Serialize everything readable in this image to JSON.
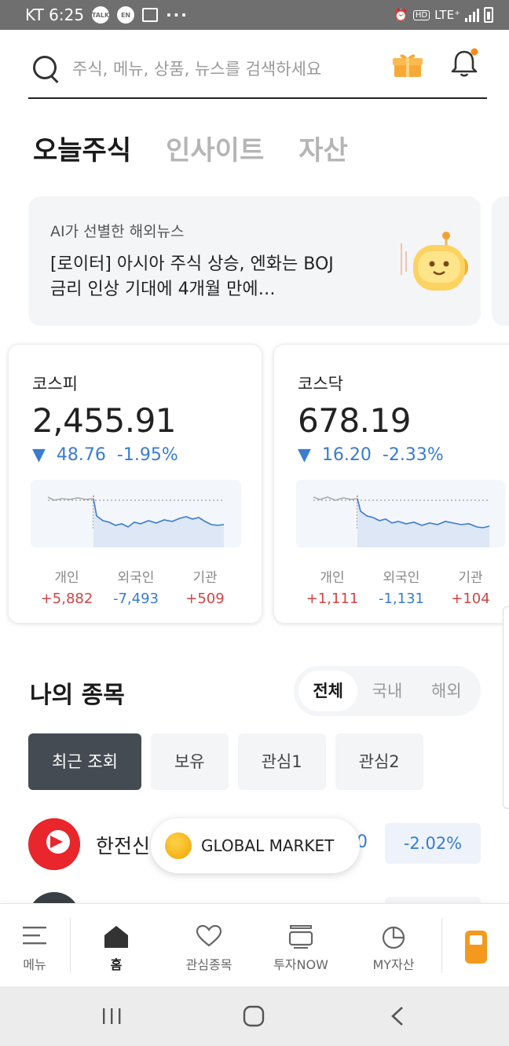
{
  "status_bar": {
    "carrier_time": "KT 6:25",
    "icons": [
      "talk-icon",
      "shield-icon",
      "gallery-icon"
    ],
    "more": "···",
    "hd": "HD",
    "network": "LTE⁺"
  },
  "search": {
    "placeholder": "주식, 메뉴, 상품, 뉴스를 검색하세요"
  },
  "tabs": [
    {
      "label": "오늘주식",
      "active": true
    },
    {
      "label": "인사이트",
      "active": false
    },
    {
      "label": "자산",
      "active": false
    }
  ],
  "news": {
    "kicker": "AI가 선별한 해외뉴스",
    "headline": "[로이터] 아시아 주식 상승, 엔화는 BOJ 금리 인상 기대에 4개월 만에…"
  },
  "indices": [
    {
      "name": "코스피",
      "value": "2,455.91",
      "arrow": "▼",
      "change": "48.76",
      "rate": "-1.95%",
      "flows": [
        {
          "label": "개인",
          "value": "+5,882"
        },
        {
          "label": "외국인",
          "value": "-7,493"
        },
        {
          "label": "기관",
          "value": "+509"
        }
      ]
    },
    {
      "name": "코스닥",
      "value": "678.19",
      "arrow": "▼",
      "change": "16.20",
      "rate": "-2.33%",
      "flows": [
        {
          "label": "개인",
          "value": "+1,111"
        },
        {
          "label": "외국인",
          "value": "-1,131"
        },
        {
          "label": "기관",
          "value": "+104"
        }
      ]
    }
  ],
  "my_stocks": {
    "title": "나의 종목",
    "segments": [
      {
        "label": "전체",
        "active": true
      },
      {
        "label": "국내",
        "active": false
      },
      {
        "label": "해외",
        "active": false
      }
    ],
    "chips": [
      {
        "label": "최근 조회",
        "active": true
      },
      {
        "label": "보유",
        "active": false
      },
      {
        "label": "관심1",
        "active": false
      },
      {
        "label": "관심2",
        "active": false
      }
    ],
    "rows": [
      {
        "name": "한전신",
        "price_tail": "0",
        "rate": "-2.02%"
      }
    ]
  },
  "floating": {
    "label": "GLOBAL MARKET"
  },
  "bottom_nav": [
    {
      "label": "메뉴",
      "icon": "menu-icon",
      "active": false
    },
    {
      "label": "홈",
      "icon": "home-icon",
      "active": true
    },
    {
      "label": "관심종목",
      "icon": "heart-icon",
      "active": false
    },
    {
      "label": "투자NOW",
      "icon": "tv-icon",
      "active": false
    },
    {
      "label": "MY자산",
      "icon": "pie-chart-icon",
      "active": false
    }
  ],
  "colors": {
    "up": "#d14545",
    "down": "#3b7bd0",
    "accent": "#f39a1e"
  }
}
